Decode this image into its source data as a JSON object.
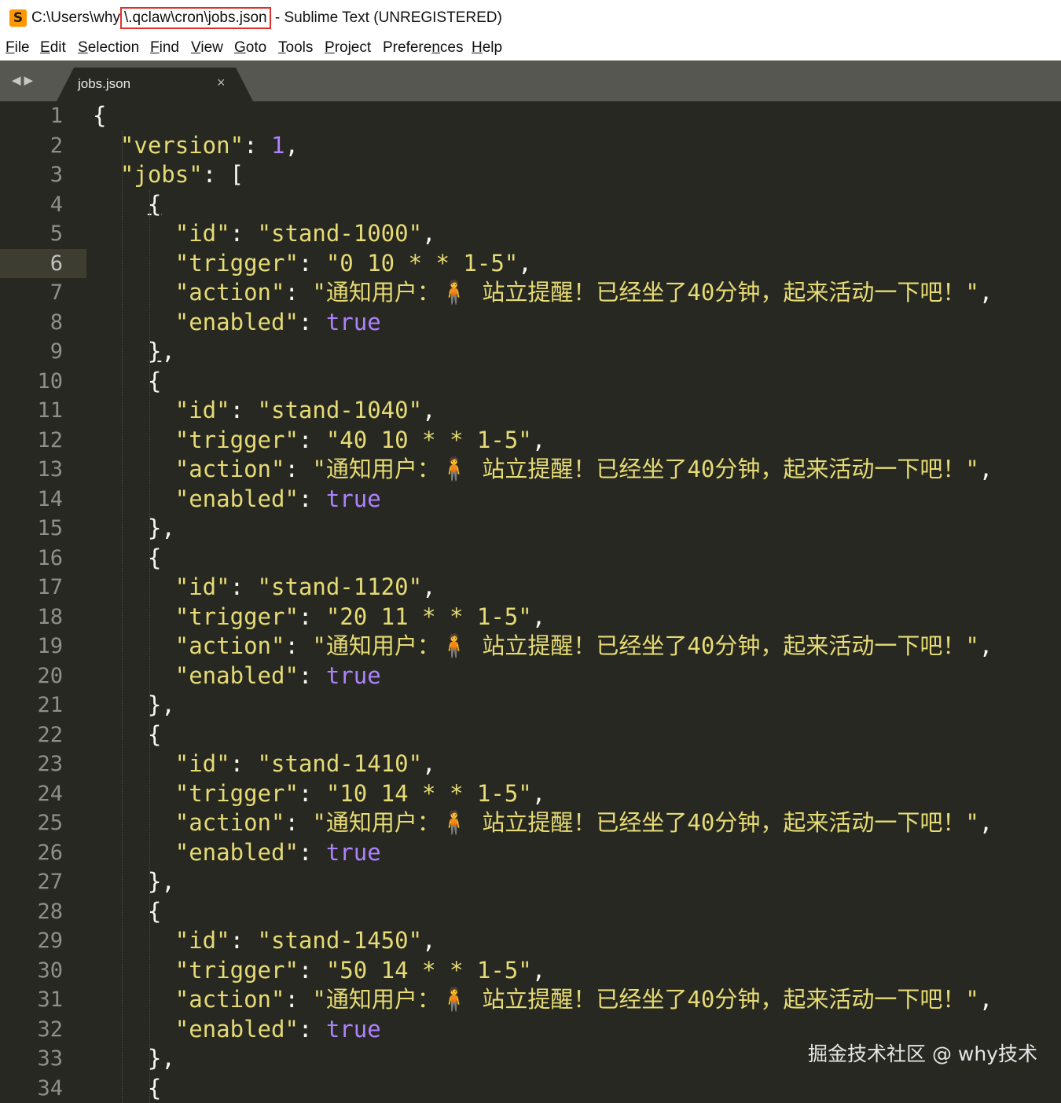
{
  "window": {
    "title_prefix": "C:\\Users\\why",
    "title_highlight": "\\.qclaw\\cron\\jobs.json",
    "title_suffix": " - Sublime Text (UNREGISTERED)",
    "highlight_color": "#e0302a"
  },
  "menu": [
    {
      "key": "F",
      "rest": "ile"
    },
    {
      "key": "E",
      "rest": "dit"
    },
    {
      "key": "S",
      "rest": "election"
    },
    {
      "key": "F",
      "rest": "ind"
    },
    {
      "key": "V",
      "rest": "iew"
    },
    {
      "key": "G",
      "rest": "oto"
    },
    {
      "key": "T",
      "rest": "ools"
    },
    {
      "key": "P",
      "rest": "roject"
    },
    {
      "pre": "Prefere",
      "key": "n",
      "rest": "ces"
    },
    {
      "key": "H",
      "rest": "elp"
    }
  ],
  "tab": {
    "label": "jobs.json",
    "close": "×"
  },
  "nav_arrows": "◀▶",
  "editor": {
    "active_line": 6,
    "theme": {
      "background": "#272822",
      "string": "#e6db74",
      "constant": "#ae81ff",
      "text": "#f8f8f2"
    },
    "jobs": [
      {
        "id": "\"stand-1000\"",
        "trigger": "\"0 10 * * 1-5\""
      },
      {
        "id": "\"stand-1040\"",
        "trigger": "\"40 10 * * 1-5\""
      },
      {
        "id": "\"stand-1120\"",
        "trigger": "\"20 11 * * 1-5\""
      },
      {
        "id": "\"stand-1410\"",
        "trigger": "\"10 14 * * 1-5\""
      },
      {
        "id": "\"stand-1450\"",
        "trigger": "\"50 14 * * 1-5\""
      }
    ],
    "action": "\"通知用户：🧍 站立提醒！已经坐了40分钟，起来活动一下吧！\"",
    "enabled": "true",
    "version": "1",
    "keys": {
      "version": "\"version\"",
      "jobs": "\"jobs\"",
      "id": "\"id\"",
      "trigger": "\"trigger\"",
      "action": "\"action\"",
      "enabled": "\"enabled\""
    }
  },
  "watermark": "掘金技术社区 @ why技术"
}
